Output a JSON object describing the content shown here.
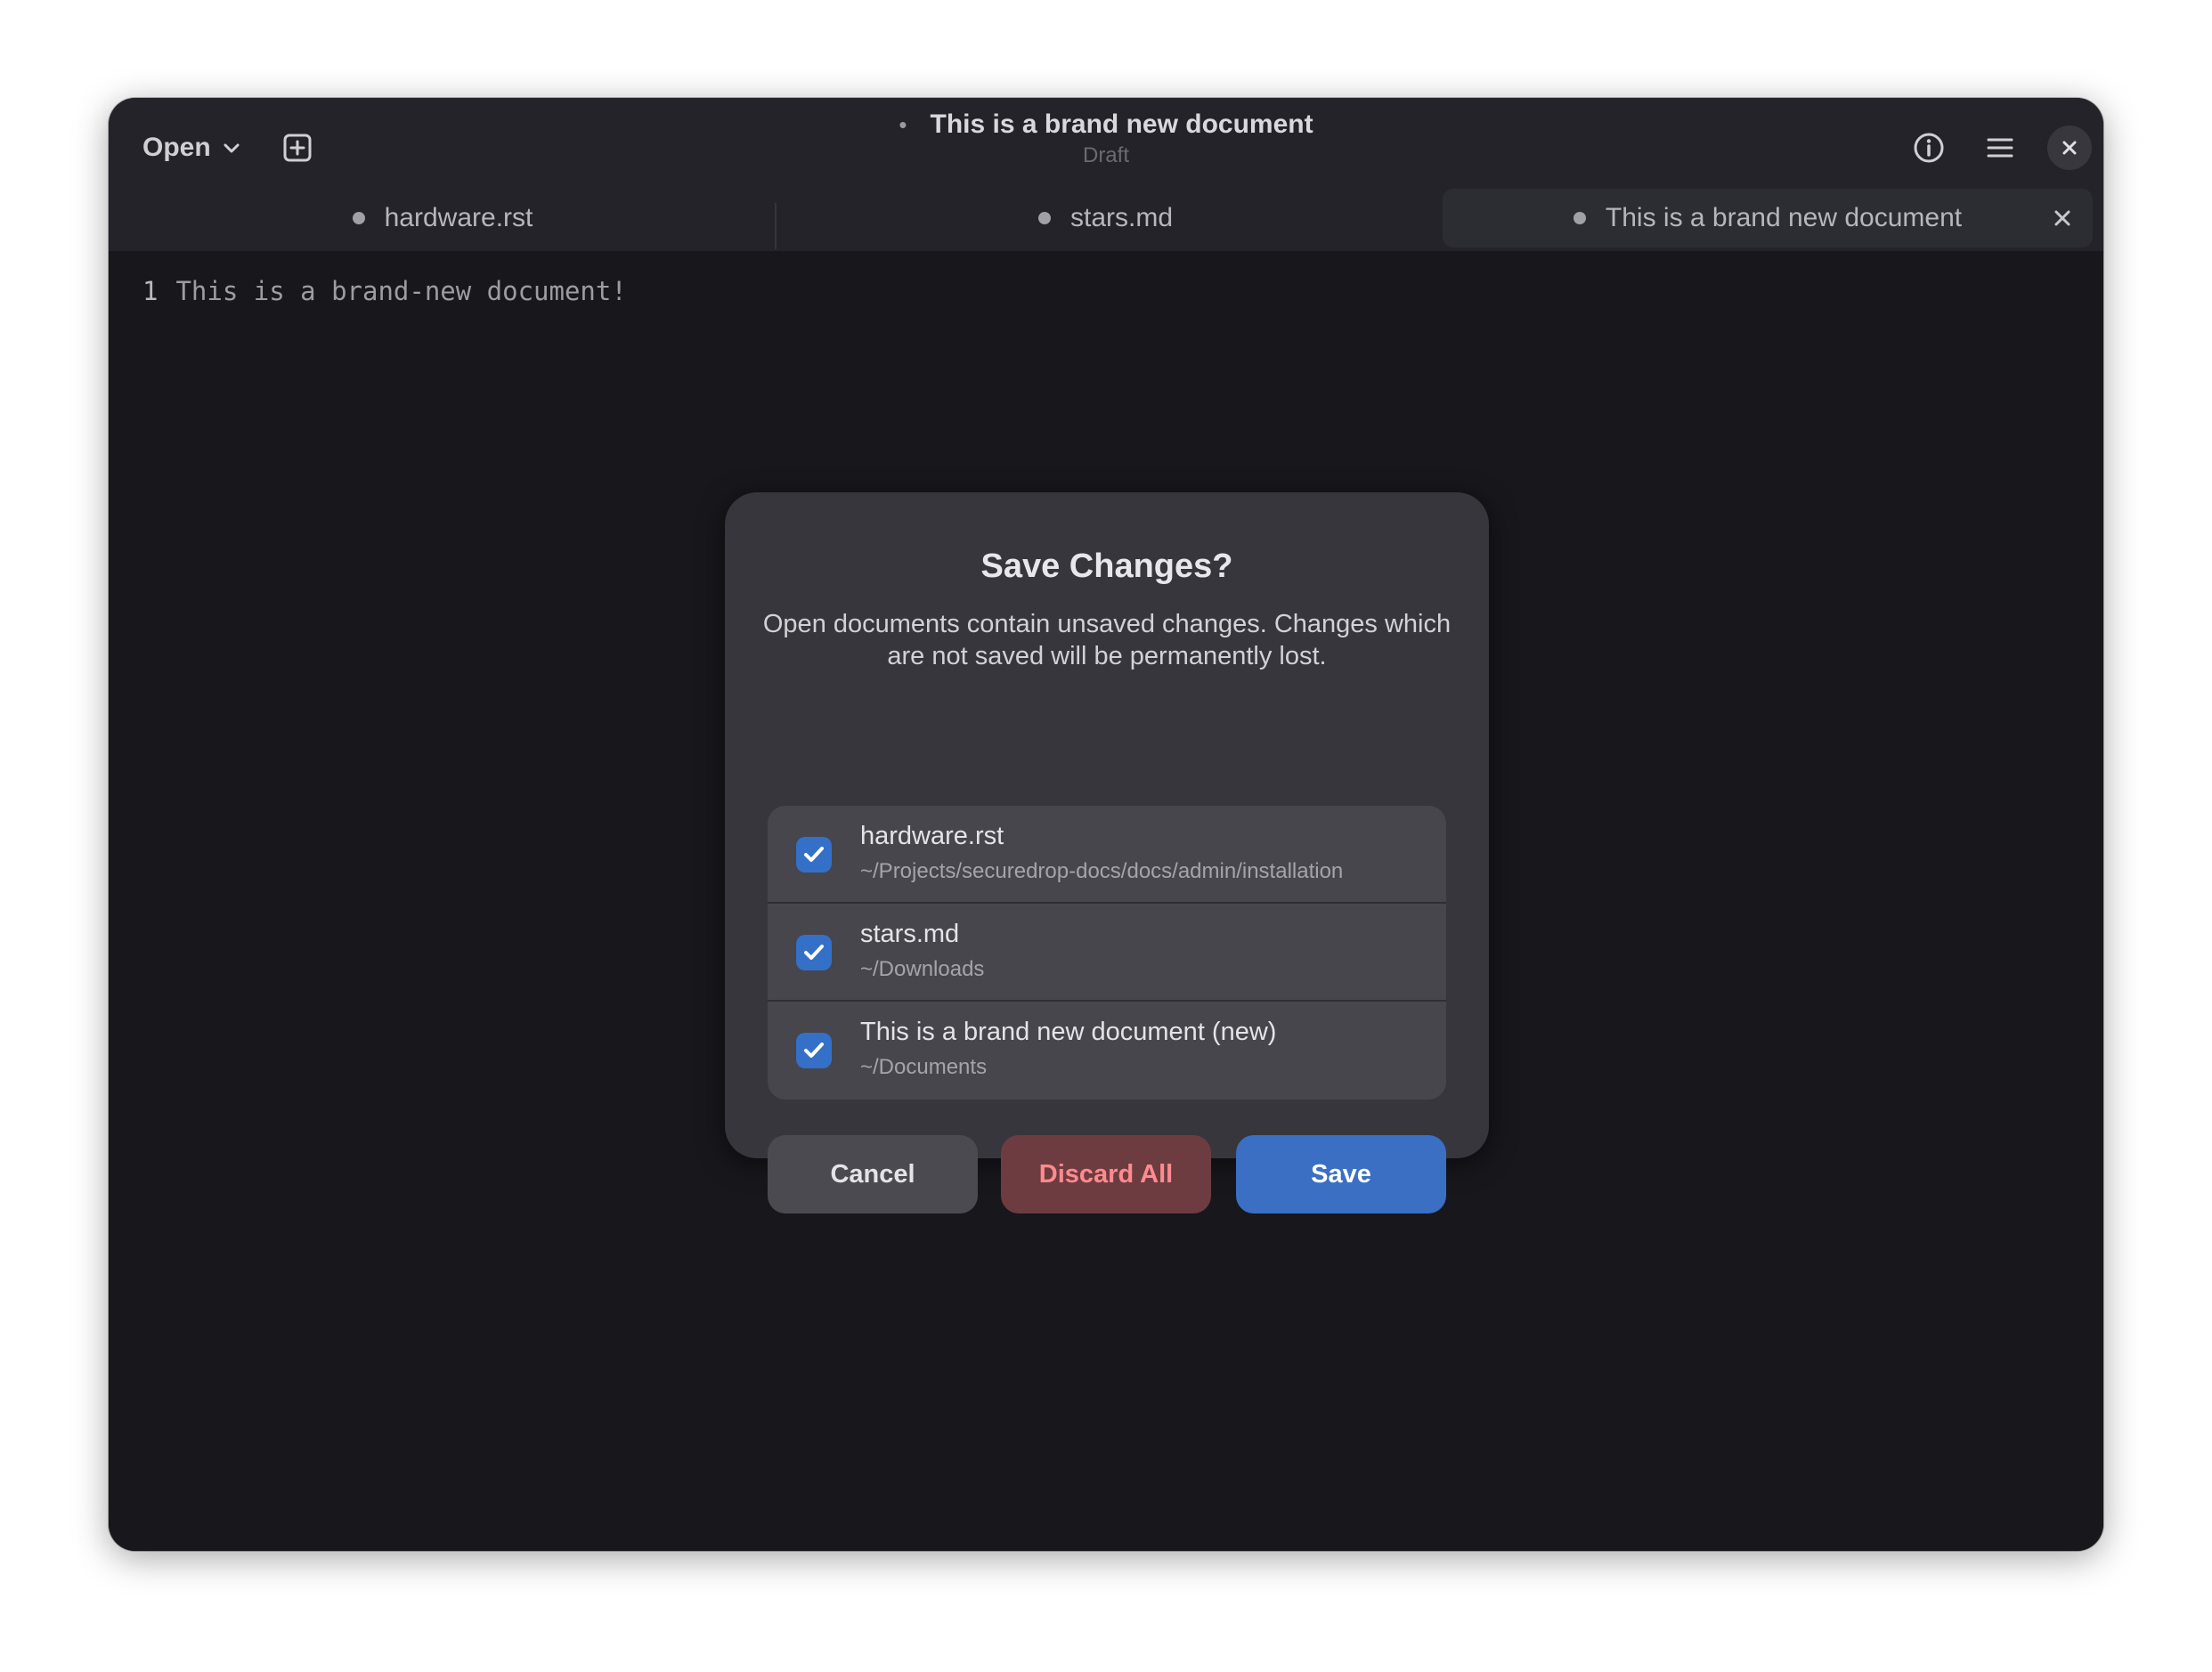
{
  "header": {
    "open_label": "Open",
    "title_dot": "•",
    "title": "This is a brand new document",
    "subtitle": "Draft"
  },
  "tabs": [
    {
      "label": "hardware.rst",
      "modified": true,
      "active": false
    },
    {
      "label": "stars.md",
      "modified": true,
      "active": false
    },
    {
      "label": "This is a brand new document",
      "modified": true,
      "active": true
    }
  ],
  "editor": {
    "lines": [
      {
        "number": "1",
        "text": "This is a brand-new document!"
      }
    ]
  },
  "dialog": {
    "title": "Save Changes?",
    "body": "Open documents contain unsaved changes. Changes which are not saved will be permanently lost.",
    "files": [
      {
        "name": "hardware.rst",
        "path": "~/Projects/securedrop-docs/docs/admin/installation",
        "checked": true
      },
      {
        "name": "stars.md",
        "path": "~/Downloads",
        "checked": true
      },
      {
        "name": "This is a brand new document (new)",
        "path": "~/Documents",
        "checked": true
      }
    ],
    "buttons": {
      "cancel": "Cancel",
      "discard": "Discard All",
      "save": "Save"
    }
  },
  "colors": {
    "accent": "#3a6fc4",
    "destructive_text": "#ff8a8f",
    "window_bg": "#17171c",
    "dialog_bg": "#36363c"
  },
  "icons": {
    "open_chevron": "chevron-down-icon",
    "new_tab": "new-tab-icon",
    "info": "info-icon",
    "menu": "hamburger-menu-icon",
    "close": "close-icon",
    "check": "checkmark-icon"
  }
}
